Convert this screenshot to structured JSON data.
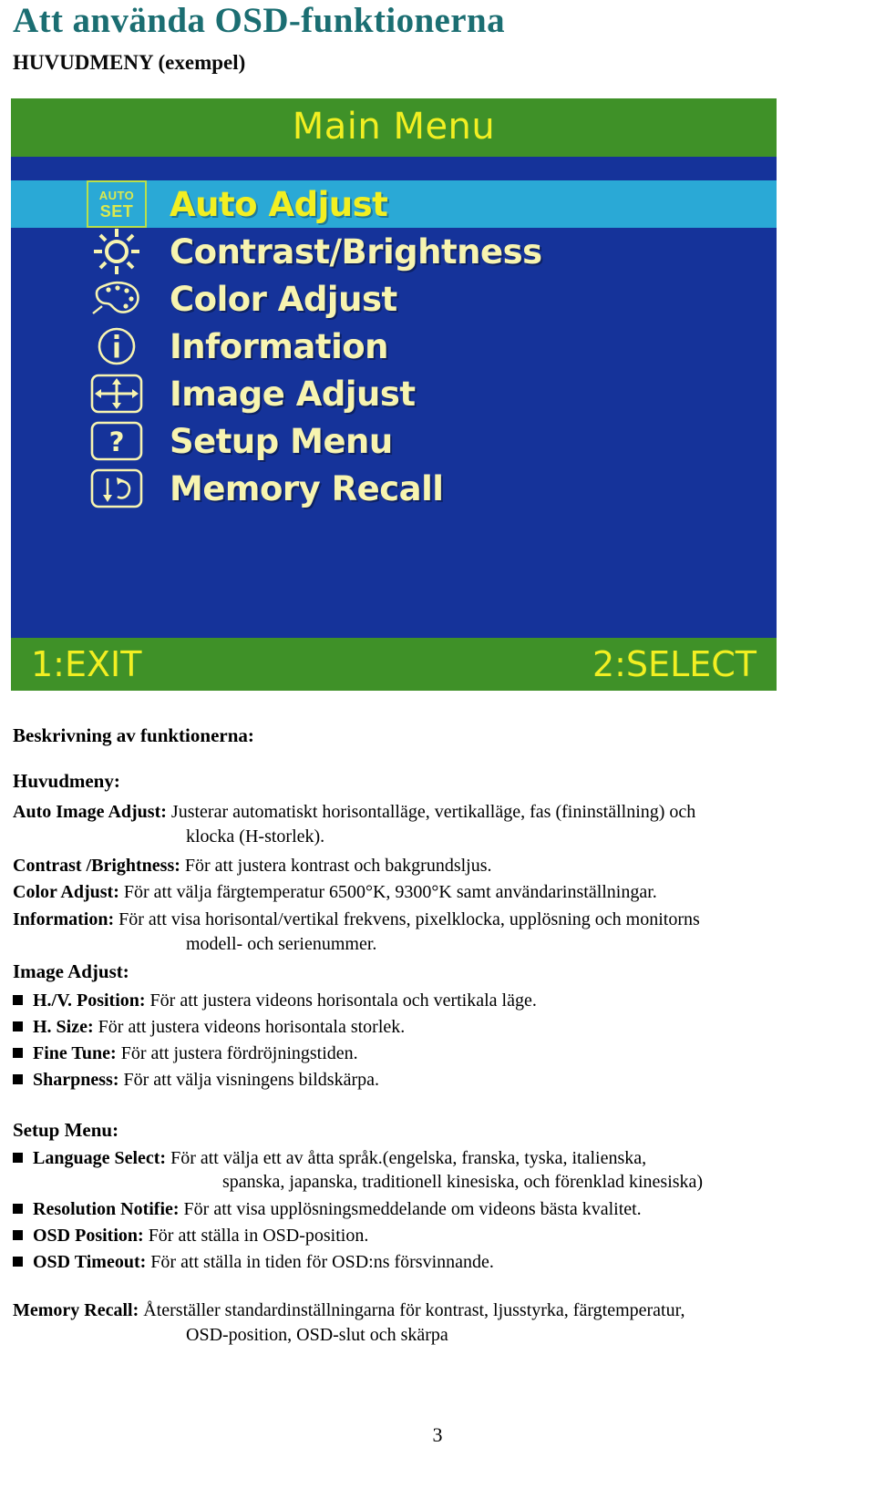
{
  "page": {
    "title": "Att använda OSD-funktionerna",
    "subtitle": "HUVUDMENY (exempel)",
    "number": "3",
    "title_color": "#1b6e72"
  },
  "osd": {
    "header_title": "Main Menu",
    "colors": {
      "header_bar": "#3f9128",
      "body": "#15339a",
      "highlight_row": "#2aa9d6",
      "label_text": "#f7f4b0",
      "header_text": "#f2ef22"
    },
    "items": [
      {
        "icon": "auto-set-icon",
        "label": "Auto Adjust",
        "selected": true
      },
      {
        "icon": "brightness-sun-icon",
        "label": "Contrast/Brightness",
        "selected": false
      },
      {
        "icon": "color-palette-icon",
        "label": "Color Adjust",
        "selected": false
      },
      {
        "icon": "information-icon",
        "label": "Information",
        "selected": false
      },
      {
        "icon": "image-adjust-arrows-icon",
        "label": "Image Adjust",
        "selected": false
      },
      {
        "icon": "setup-question-icon",
        "label": "Setup Menu",
        "selected": false
      },
      {
        "icon": "memory-recall-icon",
        "label": "Memory Recall",
        "selected": false
      }
    ],
    "autoset_icon": {
      "line1": "AUTO",
      "line2": "SET"
    },
    "footer": {
      "left": "1:EXIT",
      "right": "2:SELECT"
    }
  },
  "content": {
    "description_heading": "Beskrivning av funktionerna:",
    "main_menu_heading": "Huvudmeny:",
    "auto_image_adjust": {
      "term": "Auto Image Adjust:",
      "text": " Justerar automatiskt horisontalläge, vertikalläge, fas (fininställning) och",
      "cont": "klocka (H-storlek)."
    },
    "contrast_brightness": {
      "term": "Contrast /Brightness:",
      "text": " För att justera kontrast och bakgrundsljus."
    },
    "color_adjust": {
      "term": "Color Adjust:",
      "text": " För att välja färgtemperatur 6500°K, 9300°K samt användarinställningar."
    },
    "information": {
      "term": "Information:",
      "text": " För att visa horisontal/vertikal frekvens, pixelklocka, upplösning och monitorns",
      "cont": "modell- och serienummer."
    },
    "image_adjust_heading": "Image Adjust:",
    "image_adjust_items": [
      {
        "term": "H./V. Position:",
        "text": " För att justera videons horisontala och vertikala läge."
      },
      {
        "term": "H. Size:",
        "text": " För att justera videons horisontala storlek."
      },
      {
        "term": "Fine Tune:",
        "text": " För att justera fördröjningstiden."
      },
      {
        "term": "Sharpness:",
        "text": " För att välja visningens bildskärpa."
      }
    ],
    "setup_menu_heading": "Setup Menu:",
    "setup_menu_items": [
      {
        "term": "Language Select:",
        "text": " För att välja ett av åtta språk.(engelska, franska, tyska, italienska,",
        "cont": "spanska, japanska, traditionell kinesiska, och förenklad kinesiska)"
      },
      {
        "term": "Resolution Notifie:",
        "text": " För att visa upplösningsmeddelande om videons bästa kvalitet."
      },
      {
        "term": "OSD Position:",
        "text": " För att ställa in OSD-position."
      },
      {
        "term": "OSD Timeout:",
        "text": " För att ställa in tiden för OSD:ns försvinnande."
      }
    ],
    "memory_recall": {
      "term": "Memory Recall:",
      "text": " Återställer standardinställningarna för kontrast, ljusstyrka, färgtemperatur,",
      "cont": "OSD-position, OSD-slut och skärpa"
    }
  }
}
